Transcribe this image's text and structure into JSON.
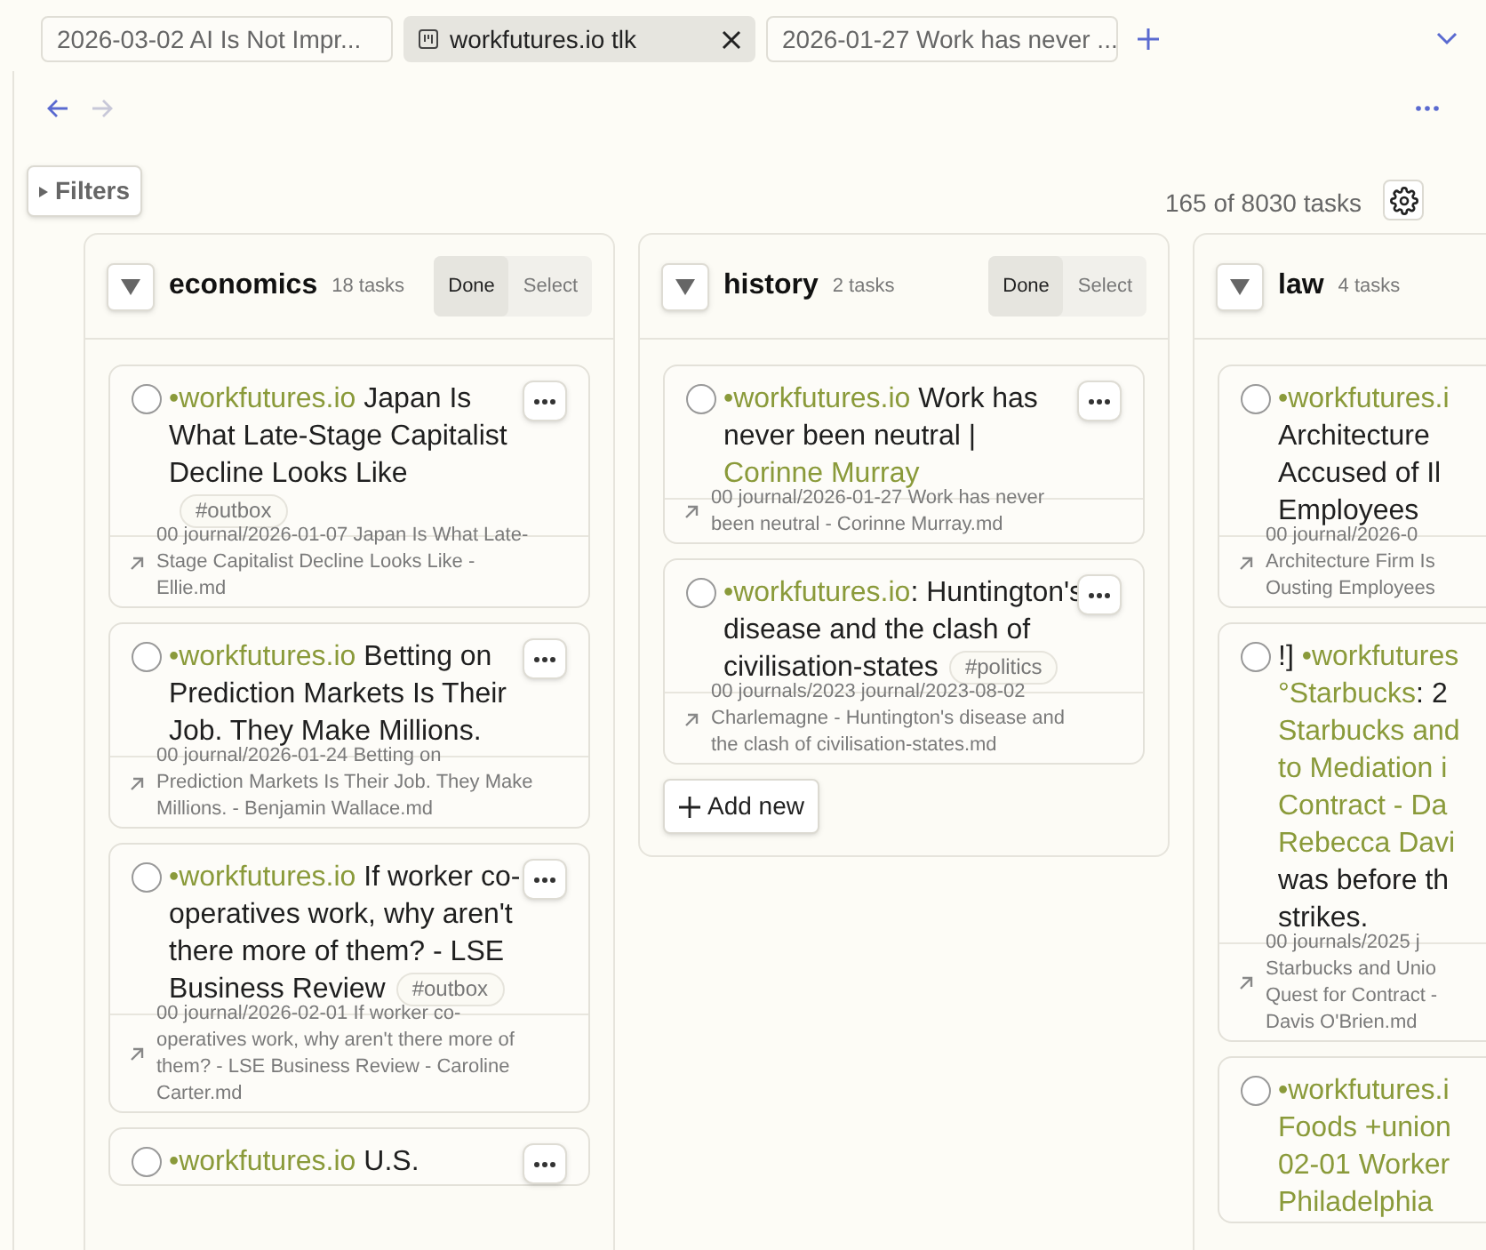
{
  "tabs": [
    {
      "label": "2026-03-02 AI Is Not Impr...",
      "selected": false
    },
    {
      "label": "workfutures.io tlk",
      "selected": true
    },
    {
      "label": "2026-01-27 Work has never ...",
      "selected": false
    }
  ],
  "nav": {
    "back_disabled": false,
    "forward_disabled": true
  },
  "filters_label": "Filters",
  "task_count": "165 of 8030 tasks",
  "columns": [
    {
      "name": "economics",
      "count": "18 tasks",
      "modes": [
        {
          "label": "Done",
          "selected": true
        },
        {
          "label": "Select",
          "selected": false
        }
      ],
      "cards": [
        {
          "checked": false,
          "lines": [
            [
              {
                "kind": "link",
                "text": "•workfutures.io"
              },
              {
                "kind": "text",
                "text": " Japan Is"
              }
            ],
            [
              {
                "kind": "text",
                "text": "What Late-Stage Capitalist"
              }
            ],
            [
              {
                "kind": "text",
                "text": "Decline Looks Like"
              }
            ],
            [
              {
                "kind": "tag",
                "text": "#outbox"
              }
            ]
          ],
          "path": [
            "00 journal/2026-01-07 Japan Is What Late-",
            "Stage Capitalist Decline Looks Like -",
            "Ellie.md"
          ]
        },
        {
          "checked": false,
          "lines": [
            [
              {
                "kind": "link",
                "text": "•workfutures.io"
              },
              {
                "kind": "text",
                "text": " Betting on"
              }
            ],
            [
              {
                "kind": "text",
                "text": "Prediction Markets Is Their"
              }
            ],
            [
              {
                "kind": "text",
                "text": "Job. They Make Millions."
              }
            ]
          ],
          "path": [
            "00 journal/2026-01-24 Betting on",
            "Prediction Markets Is Their Job. They Make",
            "Millions. - Benjamin Wallace.md"
          ]
        },
        {
          "checked": false,
          "lines": [
            [
              {
                "kind": "link",
                "text": "•workfutures.io"
              },
              {
                "kind": "text",
                "text": " If worker co-"
              }
            ],
            [
              {
                "kind": "text",
                "text": "operatives work, why aren't"
              }
            ],
            [
              {
                "kind": "text",
                "text": "there more of them? - LSE"
              }
            ],
            [
              {
                "kind": "text",
                "text": "Business Review"
              },
              {
                "kind": "tag",
                "text": "#outbox"
              }
            ]
          ],
          "path": [
            "00 journal/2026-02-01 If worker co-",
            "operatives work, why aren't there more of",
            "them? - LSE Business Review - Caroline",
            "Carter.md"
          ]
        },
        {
          "checked": false,
          "lines": [
            [
              {
                "kind": "link",
                "text": "•workfutures.io"
              },
              {
                "kind": "text",
                "text": " U.S."
              }
            ]
          ]
        }
      ]
    },
    {
      "name": "history",
      "count": "2 tasks",
      "add_label": "Add new",
      "modes": [
        {
          "label": "Done",
          "selected": true
        },
        {
          "label": "Select",
          "selected": false
        }
      ],
      "cards": [
        {
          "checked": false,
          "lines": [
            [
              {
                "kind": "link",
                "text": "•workfutures.io"
              },
              {
                "kind": "text",
                "text": " Work has"
              }
            ],
            [
              {
                "kind": "text",
                "text": "never been neutral |"
              }
            ],
            [
              {
                "kind": "link",
                "text": "Corinne Murray"
              }
            ]
          ],
          "path": [
            "00 journal/2026-01-27 Work has never",
            "been neutral - Corinne Murray.md"
          ]
        },
        {
          "checked": false,
          "lines": [
            [
              {
                "kind": "link",
                "text": "•workfutures.io"
              },
              {
                "kind": "text",
                "text": ": Huntington's"
              }
            ],
            [
              {
                "kind": "text",
                "text": "disease and the clash of"
              }
            ],
            [
              {
                "kind": "text",
                "text": "civilisation-states"
              },
              {
                "kind": "tag",
                "text": "#politics"
              }
            ]
          ],
          "path": [
            "00 journals/2023 journal/2023-08-02",
            "Charlemagne - Huntington's disease and",
            "the clash of civilisation-states.md"
          ]
        }
      ]
    },
    {
      "name": "law",
      "count": "4 tasks",
      "cards": [
        {
          "checked": false,
          "lines": [
            [
              {
                "kind": "link",
                "text": "•workfutures.i"
              }
            ],
            [
              {
                "kind": "text",
                "text": "Architecture"
              }
            ],
            [
              {
                "kind": "text",
                "text": "Accused of Il"
              }
            ],
            [
              {
                "kind": "text",
                "text": "Employees"
              }
            ]
          ],
          "path": [
            "00 journal/2026-0",
            "Architecture Firm Is",
            "Ousting Employees"
          ]
        },
        {
          "checked": false,
          "lines": [
            [
              {
                "kind": "text",
                "text": "!] "
              },
              {
                "kind": "link",
                "text": "•workfutures"
              }
            ],
            [
              {
                "kind": "link",
                "text": "°Starbucks"
              },
              {
                "kind": "text",
                "text": ": 2"
              }
            ],
            [
              {
                "kind": "link",
                "text": "Starbucks and"
              }
            ],
            [
              {
                "kind": "link",
                "text": "to Mediation i"
              }
            ],
            [
              {
                "kind": "link",
                "text": "Contract - Da"
              }
            ],
            [
              {
                "kind": "link",
                "text": "Rebecca Davi"
              }
            ],
            [
              {
                "kind": "text",
                "text": "was before th"
              }
            ],
            [
              {
                "kind": "text",
                "text": "strikes."
              }
            ]
          ],
          "path": [
            "00 journals/2025 j",
            "Starbucks and Unio",
            "Quest for Contract -",
            "Davis O'Brien.md"
          ]
        },
        {
          "checked": false,
          "lines": [
            [
              {
                "kind": "link",
                "text": "•workfutures.i"
              }
            ],
            [
              {
                "kind": "link",
                "text": "Foods +union"
              }
            ],
            [
              {
                "kind": "link",
                "text": "02-01 Worker"
              }
            ],
            [
              {
                "kind": "link",
                "text": "Philadelphia"
              }
            ]
          ]
        }
      ]
    }
  ]
}
